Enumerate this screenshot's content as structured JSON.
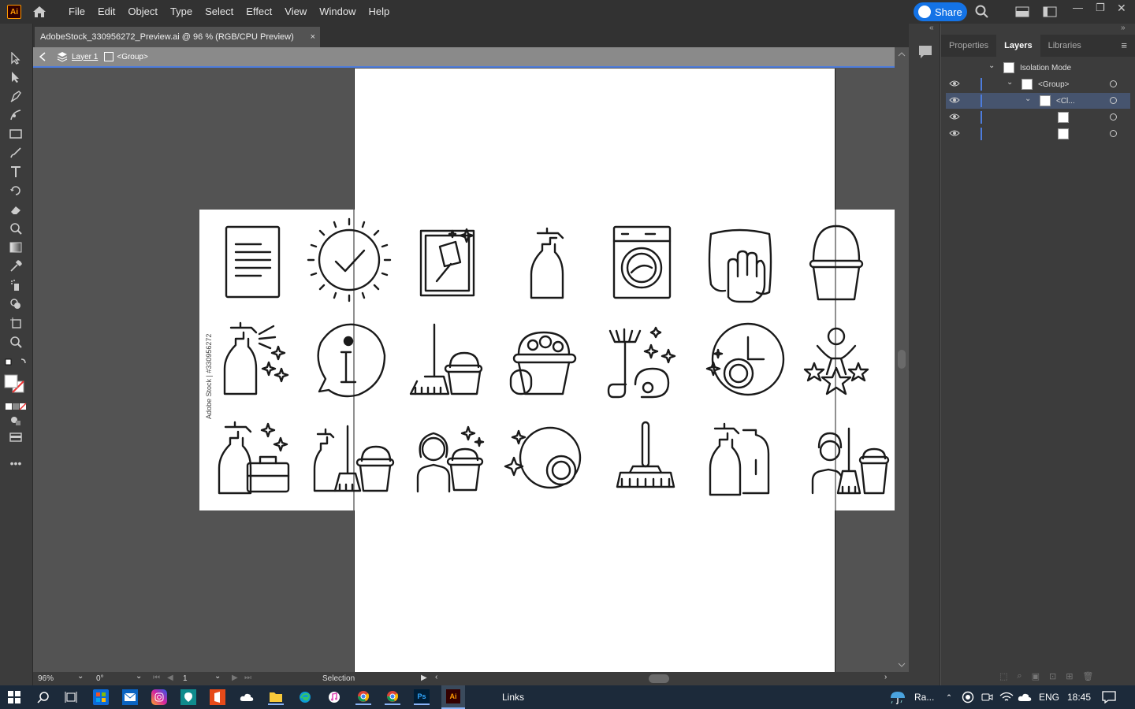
{
  "app": {
    "logo": "Ai",
    "share_label": "Share"
  },
  "menu": [
    "File",
    "Edit",
    "Object",
    "Type",
    "Select",
    "Effect",
    "View",
    "Window",
    "Help"
  ],
  "document": {
    "tab_title": "AdobeStock_330956272_Preview.ai @ 96 % (RGB/CPU Preview)",
    "close": "×"
  },
  "isolation": {
    "layer": "Layer 1",
    "group": "<Group>"
  },
  "artwork": {
    "watermark": "Adobe Stock | #330956272"
  },
  "status": {
    "zoom": "96%",
    "rotation": "0°",
    "artboard": "1",
    "mode": "Selection"
  },
  "panel": {
    "tabs": [
      "Properties",
      "Layers",
      "Libraries"
    ],
    "layers": [
      {
        "name": "Isolation Mode"
      },
      {
        "name": "<Group>"
      },
      {
        "name": "<Cl..."
      }
    ]
  },
  "taskbar": {
    "links": "Links",
    "weather": "Ra...",
    "lang": "ENG",
    "time": "18:45"
  },
  "colors": {
    "accent": "#1473e6",
    "selection": "#4d7cdc",
    "ui_dark": "#323232",
    "ui_mid": "#535353"
  }
}
